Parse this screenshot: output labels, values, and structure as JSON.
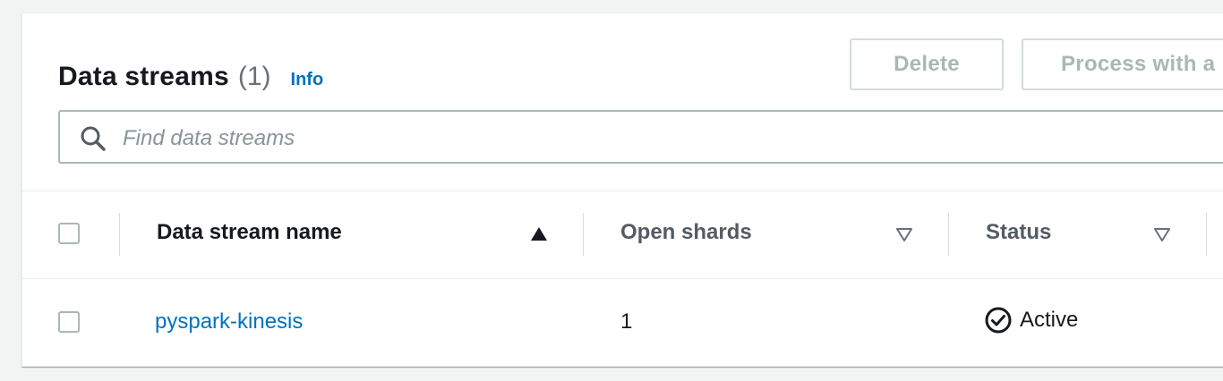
{
  "header": {
    "title": "Data streams",
    "count": "(1)",
    "info_link": "Info"
  },
  "actions": {
    "delete_label": "Delete",
    "process_label": "Process with a"
  },
  "search": {
    "placeholder": "Find data streams",
    "value": ""
  },
  "table": {
    "columns": [
      {
        "label": "Data stream name",
        "sort": "ascending"
      },
      {
        "label": "Open shards",
        "sort": "none"
      },
      {
        "label": "Status",
        "sort": "none"
      }
    ],
    "rows": [
      {
        "name": "pyspark-kinesis",
        "open_shards": "1",
        "status": "Active"
      }
    ]
  },
  "colors": {
    "link": "#0073bb",
    "status_success": "#1d8102",
    "disabled_text": "#aab7b8"
  },
  "icons": {
    "search": "search-icon",
    "sort_asc": "sort-ascending-icon",
    "sort_none": "sort-descending-icon",
    "status": "status-active-icon"
  }
}
